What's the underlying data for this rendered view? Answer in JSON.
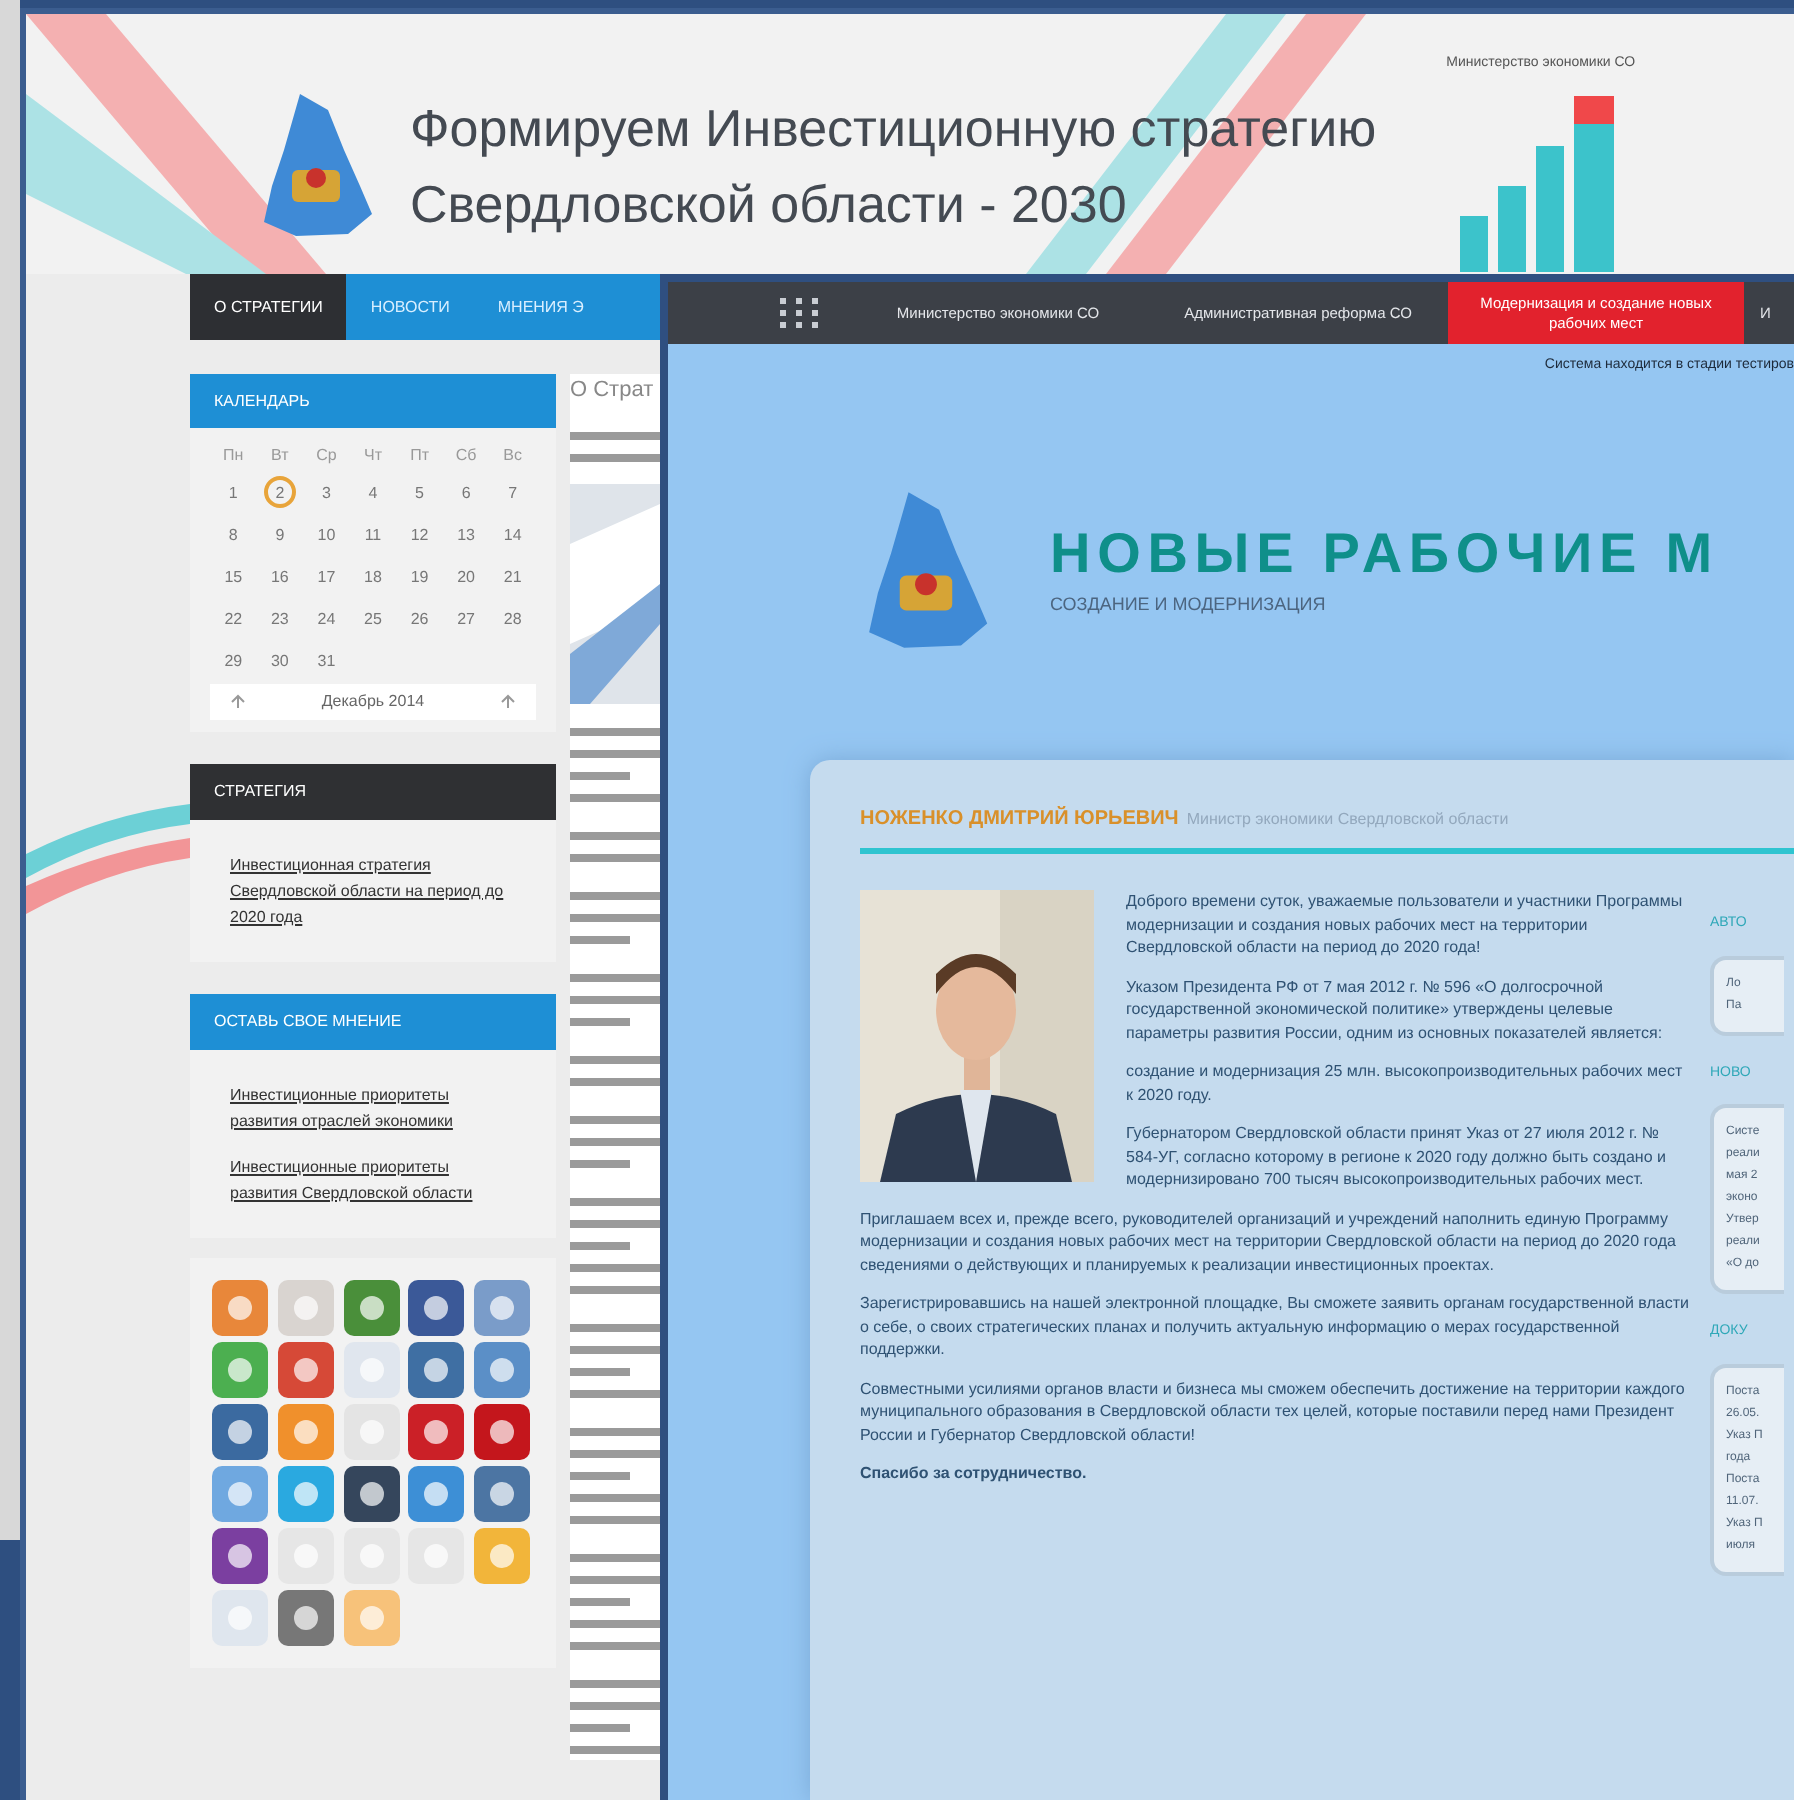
{
  "strategy_site": {
    "title_lines": [
      "Формируем Инвестиционную стратегию",
      "Свердловской области - 2030"
    ],
    "ministry_label": "Министерство экономики СО",
    "nav": [
      {
        "label": "О СТРАТЕГИИ",
        "selected": true
      },
      {
        "label": "НОВОСТИ",
        "selected": false
      },
      {
        "label": "МНЕНИЯ Э",
        "selected": false
      }
    ],
    "calendar": {
      "title": "КАЛЕНДАРЬ",
      "weekdays": [
        "Пн",
        "Вт",
        "Ср",
        "Чт",
        "Пт",
        "Сб",
        "Вс"
      ],
      "days": [
        {
          "label": "1",
          "selected": false
        },
        {
          "label": "2",
          "selected": true
        },
        {
          "label": "3",
          "selected": false
        },
        {
          "label": "4",
          "selected": false
        },
        {
          "label": "5",
          "selected": false
        },
        {
          "label": "6",
          "selected": false
        },
        {
          "label": "7",
          "selected": false
        },
        {
          "label": "8",
          "selected": false
        },
        {
          "label": "9",
          "selected": false
        },
        {
          "label": "10",
          "selected": false
        },
        {
          "label": "11",
          "selected": false
        },
        {
          "label": "12",
          "selected": false
        },
        {
          "label": "13",
          "selected": false
        },
        {
          "label": "14",
          "selected": false
        },
        {
          "label": "15",
          "selected": false
        },
        {
          "label": "16",
          "selected": false
        },
        {
          "label": "17",
          "selected": false
        },
        {
          "label": "18",
          "selected": false
        },
        {
          "label": "19",
          "selected": false
        },
        {
          "label": "20",
          "selected": false
        },
        {
          "label": "21",
          "selected": false
        },
        {
          "label": "22",
          "selected": false
        },
        {
          "label": "23",
          "selected": false
        },
        {
          "label": "24",
          "selected": false
        },
        {
          "label": "25",
          "selected": false
        },
        {
          "label": "26",
          "selected": false
        },
        {
          "label": "27",
          "selected": false
        },
        {
          "label": "28",
          "selected": false
        },
        {
          "label": "29",
          "selected": false
        },
        {
          "label": "30",
          "selected": false
        },
        {
          "label": "31",
          "selected": false
        }
      ],
      "month": "Декабрь 2014"
    },
    "blocks": [
      {
        "title": "СТРАТЕГИЯ",
        "kind": "dark",
        "links": [
          "Инвестиционная стратегия Свердловской области на период до 2020 года"
        ]
      },
      {
        "title": "ОСТАВЬ СВОЕ МНЕНИЕ",
        "kind": "blue",
        "links": [
          "Инвестиционные приоритеты развития отраслей экономики",
          "Инвестиционные приоритеты развития Свердловской области"
        ]
      }
    ],
    "share_icons": [
      {
        "color": "#e8873a"
      },
      {
        "color": "#d9d4d0"
      },
      {
        "color": "#4a8f3a"
      },
      {
        "color": "#3b5998"
      },
      {
        "color": "#7a9cc9"
      },
      {
        "color": "#4caf50"
      },
      {
        "color": "#d64937"
      },
      {
        "color": "#e0e6ee"
      },
      {
        "color": "#3f6fa3"
      },
      {
        "color": "#5b8fc7"
      },
      {
        "color": "#3b6aa0"
      },
      {
        "color": "#f0902c"
      },
      {
        "color": "#e4e4e4"
      },
      {
        "color": "#cb2027"
      },
      {
        "color": "#c4161c"
      },
      {
        "color": "#6fa8e0"
      },
      {
        "color": "#2aa9e0"
      },
      {
        "color": "#35465c"
      },
      {
        "color": "#3d8fd6"
      },
      {
        "color": "#4c75a3"
      },
      {
        "color": "#7b3fa0"
      },
      {
        "color": "#e6e6e6"
      },
      {
        "color": "#e6e6e6"
      },
      {
        "color": "#e6e6e6"
      },
      {
        "color": "#f2b53a"
      },
      {
        "color": "#dfe6ee"
      },
      {
        "color": "#777777"
      },
      {
        "color": "#f7c27a"
      }
    ],
    "article_heading": "О Страт"
  },
  "jobs_site": {
    "nav": [
      {
        "label": "Министерство экономики СО",
        "selected": false
      },
      {
        "label": "Административная реформа СО",
        "selected": false
      },
      {
        "label": "Модернизация и создание новых рабочих мест",
        "selected": true
      },
      {
        "label": "И",
        "selected": false
      }
    ],
    "notice": "Система находится в стадии тестиров",
    "title": "НОВЫЕ РАБОЧИЕ М",
    "subtitle": "СОЗДАНИЕ И МОДЕРНИЗАЦИЯ",
    "author": {
      "name": "НОЖЕНКО ДМИТРИЙ ЮРЬЕВИЧ",
      "position": "Министр экономики Свердловской области"
    },
    "paragraphs": [
      "Доброго времени суток, уважаемые пользователи и участники Программы модернизации и создания новых рабочих мест на территории Свердловской области на период до 2020 года!",
      "Указом Президента РФ от 7 мая 2012 г. № 596 «О долгосрочной государственной экономической политике» утверждены целевые параметры развития России, одним из основных показателей является:",
      "создание и модернизация 25 млн. высокопроизводительных рабочих мест к 2020 году.",
      "Губернатором Свердловской области принят Указ от 27 июля 2012 г. № 584-УГ, согласно которому в регионе к 2020 году должно быть создано и модернизировано 700 тысяч высокопроизводительных рабочих мест.",
      "Приглашаем всех и, прежде всего, руководителей организаций и учреждений наполнить единую Программу модернизации и создания новых рабочих мест на территории Свердловской области на период до 2020 года сведениями о действующих и планируемых к реализации инвестиционных проектах.",
      "Зарегистрировавшись на нашей электронной площадке, Вы сможете заявить органам государственной власти о себе, о своих стратегических планах и получить актуальную информацию о мерах государственной поддержки.",
      "Совместными усилиями органов власти и бизнеса мы сможем обеспечить достижение на территории каждого муниципального образования в Свердловской области тех целей, которые поставили перед нами Президент России и Губернатор Свердловской области!"
    ],
    "closing": "Спасибо за сотрудничество.",
    "sidebar": [
      {
        "heading": "АВТО",
        "lines": [
          "Ло",
          "Па"
        ]
      },
      {
        "heading": "НОВО",
        "lines": [
          "Систе",
          "реали",
          "мая 2",
          "эконо",
          "Утвер",
          "реали",
          "«О до"
        ]
      },
      {
        "heading": "ДОКУ",
        "lines": [
          "Поста",
          "26.05.",
          "Указ П",
          "года",
          "Поста",
          "11.07.",
          "Указ П",
          "июля"
        ]
      }
    ]
  }
}
